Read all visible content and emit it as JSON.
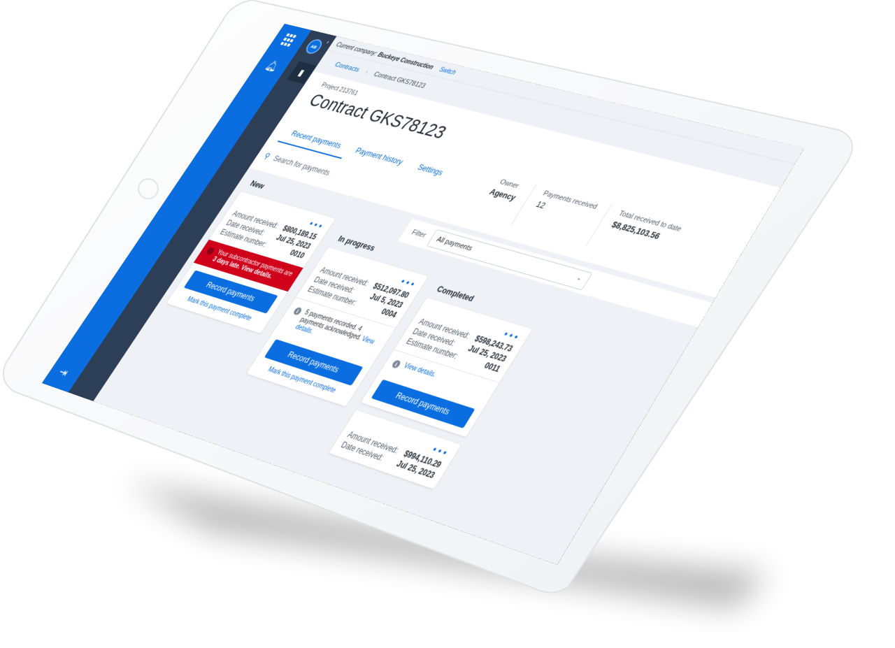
{
  "app": {
    "avatar_initials": "AB",
    "current_company_label": "Current company:",
    "current_company": "Buckeye Construction",
    "switch_label": "Switch"
  },
  "breadcrumb": {
    "link": "Contracts",
    "current": "Contract GKS78123"
  },
  "header": {
    "project_label": "Project 213761",
    "title": "Contract GKS78123"
  },
  "tabs": [
    {
      "label": "Recent payments",
      "active": true
    },
    {
      "label": "Payment history",
      "active": false
    },
    {
      "label": "Settings",
      "active": false
    }
  ],
  "stats": {
    "owner_label": "Owner",
    "owner_value": "Agency",
    "payments_label": "Payments received",
    "payments_value": "12",
    "total_label": "Total received to date",
    "total_value": "$8,825,103.56"
  },
  "search": {
    "placeholder": "Search for payments"
  },
  "filter": {
    "label": "Filter",
    "selected": "All payments"
  },
  "labels": {
    "amount": "Amount received:",
    "date": "Date received:",
    "estimate": "Estimate number:",
    "record_button": "Record payments",
    "complete_link": "Mark this payment complete"
  },
  "columns": {
    "new": {
      "title": "New",
      "card": {
        "amount": "$800,189.15",
        "date": "Jul 25, 2023",
        "estimate": "0010",
        "alert_pre": "Your subcontractor payments are",
        "alert_bold": "3 days late. View details."
      }
    },
    "in_progress": {
      "title": "In progress",
      "card": {
        "amount": "$512,097.80",
        "date": "Jul 5, 2023",
        "estimate": "0004",
        "note": "5 payments recorded. 4 payments acknowledged.",
        "note_link": "View details."
      }
    },
    "completed": {
      "title": "Completed",
      "cards": [
        {
          "amount": "$598,243.73",
          "date": "Jul 25, 2023",
          "estimate": "0011",
          "note_link": "View details."
        },
        {
          "amount": "$994,110.29",
          "date": "Jul 25, 2023"
        }
      ]
    }
  },
  "colors": {
    "primary": "#0a6ee0",
    "rail_dark": "#2d3f56",
    "alert": "#d0021b",
    "board_bg": "#eef1f5"
  }
}
